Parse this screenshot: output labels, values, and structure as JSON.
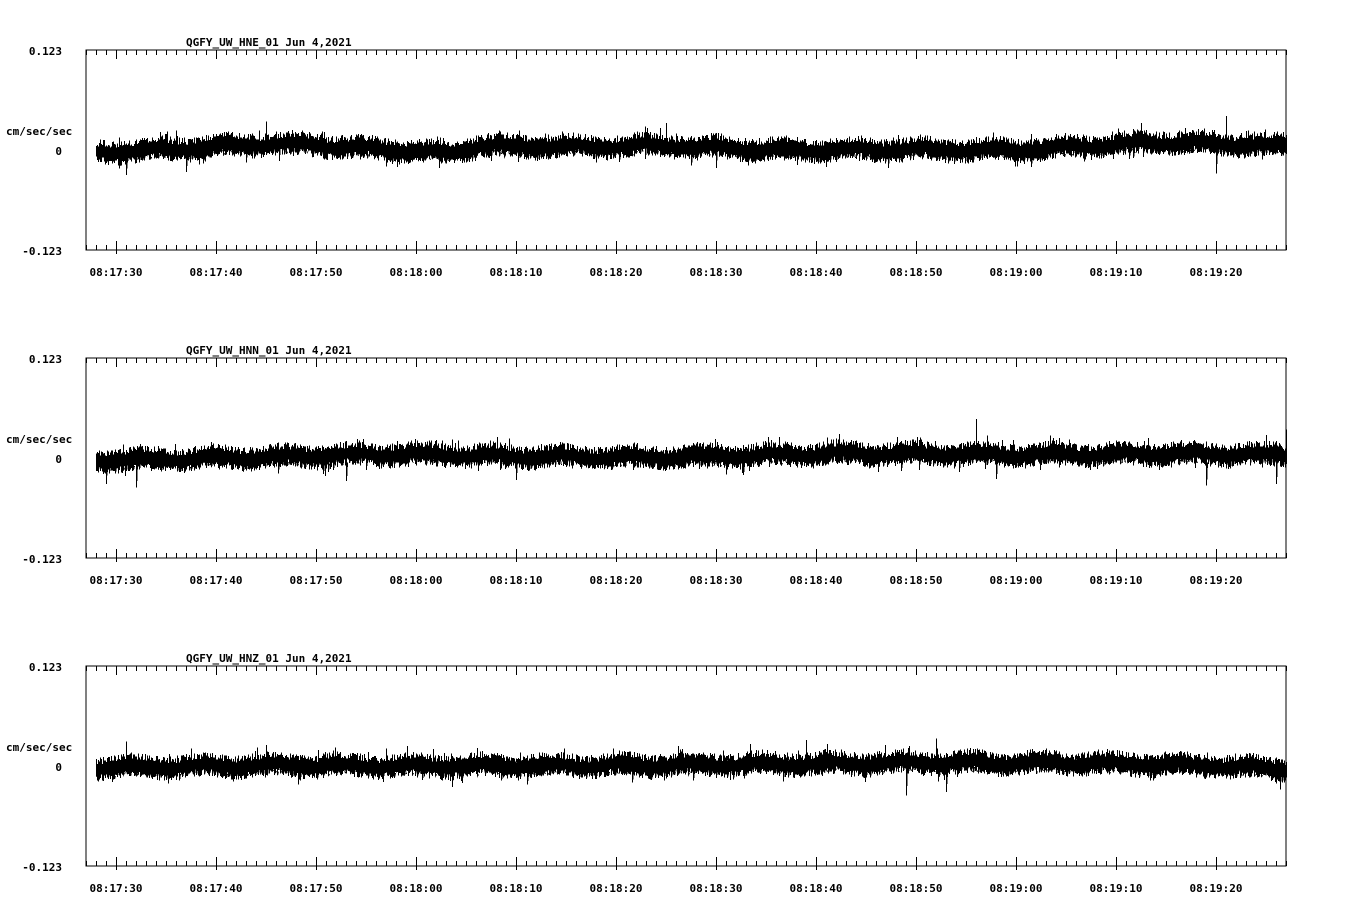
{
  "colors": {
    "background": "#ffffff",
    "trace": "#000000",
    "axis": "#000000"
  },
  "chart_data": [
    {
      "type": "line",
      "title": "QGFY_UW_HNE_01   Jun 4,2021",
      "ylabel": "cm/sec/sec",
      "ylim": [
        -0.123,
        0.123
      ],
      "ytick_labels": [
        "0.123",
        "0",
        "-0.123"
      ],
      "xlim_seconds": [
        "08:17:27",
        "08:19:27"
      ],
      "xtick_labels": [
        "08:17:30",
        "08:17:40",
        "08:17:50",
        "08:18:00",
        "08:18:10",
        "08:18:20",
        "08:18:30",
        "08:18:40",
        "08:18:50",
        "08:19:00",
        "08:19:10",
        "08:19:20"
      ],
      "series": [
        {
          "trace_start": "08:17:28",
          "trace_end": "08:19:27",
          "baseline": 0,
          "noise_amplitude": 0.011,
          "drift": [
            [
              "08:17:28",
              -0.003
            ],
            [
              "08:17:35",
              0.001
            ],
            [
              "08:17:45",
              0.008
            ],
            [
              "08:17:50",
              0.006
            ],
            [
              "08:18:03",
              -0.004
            ],
            [
              "08:18:06",
              0.005
            ],
            [
              "08:18:15",
              0.004
            ],
            [
              "08:18:25",
              0.006
            ],
            [
              "08:18:35",
              0.0
            ],
            [
              "08:18:48",
              0.001
            ],
            [
              "08:19:00",
              0.0
            ],
            [
              "08:19:15",
              0.01
            ],
            [
              "08:19:27",
              0.005
            ]
          ],
          "peaks": [
            [
              "08:17:31",
              -0.031
            ],
            [
              "08:17:37",
              -0.027
            ],
            [
              "08:17:45",
              0.035
            ],
            [
              "08:18:25",
              0.033
            ],
            [
              "08:18:30",
              -0.022
            ],
            [
              "08:19:20",
              -0.029
            ],
            [
              "08:19:21",
              0.042
            ]
          ]
        }
      ]
    },
    {
      "type": "line",
      "title": "QGFY_UW_HNN_01   Jun 4,2021",
      "ylabel": "cm/sec/sec",
      "ylim": [
        -0.123,
        0.123
      ],
      "ytick_labels": [
        "0.123",
        "0",
        "-0.123"
      ],
      "xlim_seconds": [
        "08:17:27",
        "08:19:27"
      ],
      "xtick_labels": [
        "08:17:30",
        "08:17:40",
        "08:17:50",
        "08:18:00",
        "08:18:10",
        "08:18:20",
        "08:18:30",
        "08:18:40",
        "08:18:50",
        "08:19:00",
        "08:19:10",
        "08:19:20"
      ],
      "series": [
        {
          "trace_start": "08:17:28",
          "trace_end": "08:19:27",
          "baseline": 0,
          "noise_amplitude": 0.011,
          "drift": [
            [
              "08:17:28",
              -0.003
            ],
            [
              "08:17:40",
              0.0
            ],
            [
              "08:17:58",
              0.005
            ],
            [
              "08:18:10",
              0.002
            ],
            [
              "08:18:20",
              0.001
            ],
            [
              "08:18:30",
              0.002
            ],
            [
              "08:18:42",
              0.006
            ],
            [
              "08:18:50",
              0.005
            ],
            [
              "08:19:00",
              0.004
            ],
            [
              "08:19:15",
              0.005
            ],
            [
              "08:19:27",
              0.004
            ]
          ],
          "peaks": [
            [
              "08:17:29",
              -0.032
            ],
            [
              "08:17:32",
              -0.036
            ],
            [
              "08:17:53",
              -0.028
            ],
            [
              "08:18:10",
              -0.027
            ],
            [
              "08:18:56",
              0.048
            ],
            [
              "08:18:58",
              -0.026
            ],
            [
              "08:19:19",
              -0.034
            ],
            [
              "08:19:26",
              -0.032
            ],
            [
              "08:19:27",
              0.035
            ]
          ]
        }
      ]
    },
    {
      "type": "line",
      "title": "QGFY_UW_HNZ_01   Jun 4,2021",
      "ylabel": "cm/sec/sec",
      "ylim": [
        -0.123,
        0.123
      ],
      "ytick_labels": [
        "0.123",
        "0",
        "-0.123"
      ],
      "xlim_seconds": [
        "08:17:27",
        "08:19:27"
      ],
      "xtick_labels": [
        "08:17:30",
        "08:17:40",
        "08:17:50",
        "08:18:00",
        "08:18:10",
        "08:18:20",
        "08:18:30",
        "08:18:40",
        "08:18:50",
        "08:19:00",
        "08:19:10",
        "08:19:20"
      ],
      "series": [
        {
          "trace_start": "08:17:28",
          "trace_end": "08:19:27",
          "baseline": 0,
          "noise_amplitude": 0.011,
          "drift": [
            [
              "08:17:28",
              -0.002
            ],
            [
              "08:17:45",
              0.001
            ],
            [
              "08:18:00",
              0.0
            ],
            [
              "08:18:20",
              0.001
            ],
            [
              "08:18:40",
              0.003
            ],
            [
              "08:18:50",
              0.004
            ],
            [
              "08:19:05",
              0.004
            ],
            [
              "08:19:15",
              0.002
            ],
            [
              "08:19:27",
              -0.003
            ]
          ],
          "peaks": [
            [
              "08:17:31",
              0.03
            ],
            [
              "08:18:39",
              0.032
            ],
            [
              "08:18:49",
              -0.036
            ],
            [
              "08:18:52",
              0.034
            ],
            [
              "08:18:53",
              -0.032
            ]
          ]
        }
      ]
    }
  ]
}
